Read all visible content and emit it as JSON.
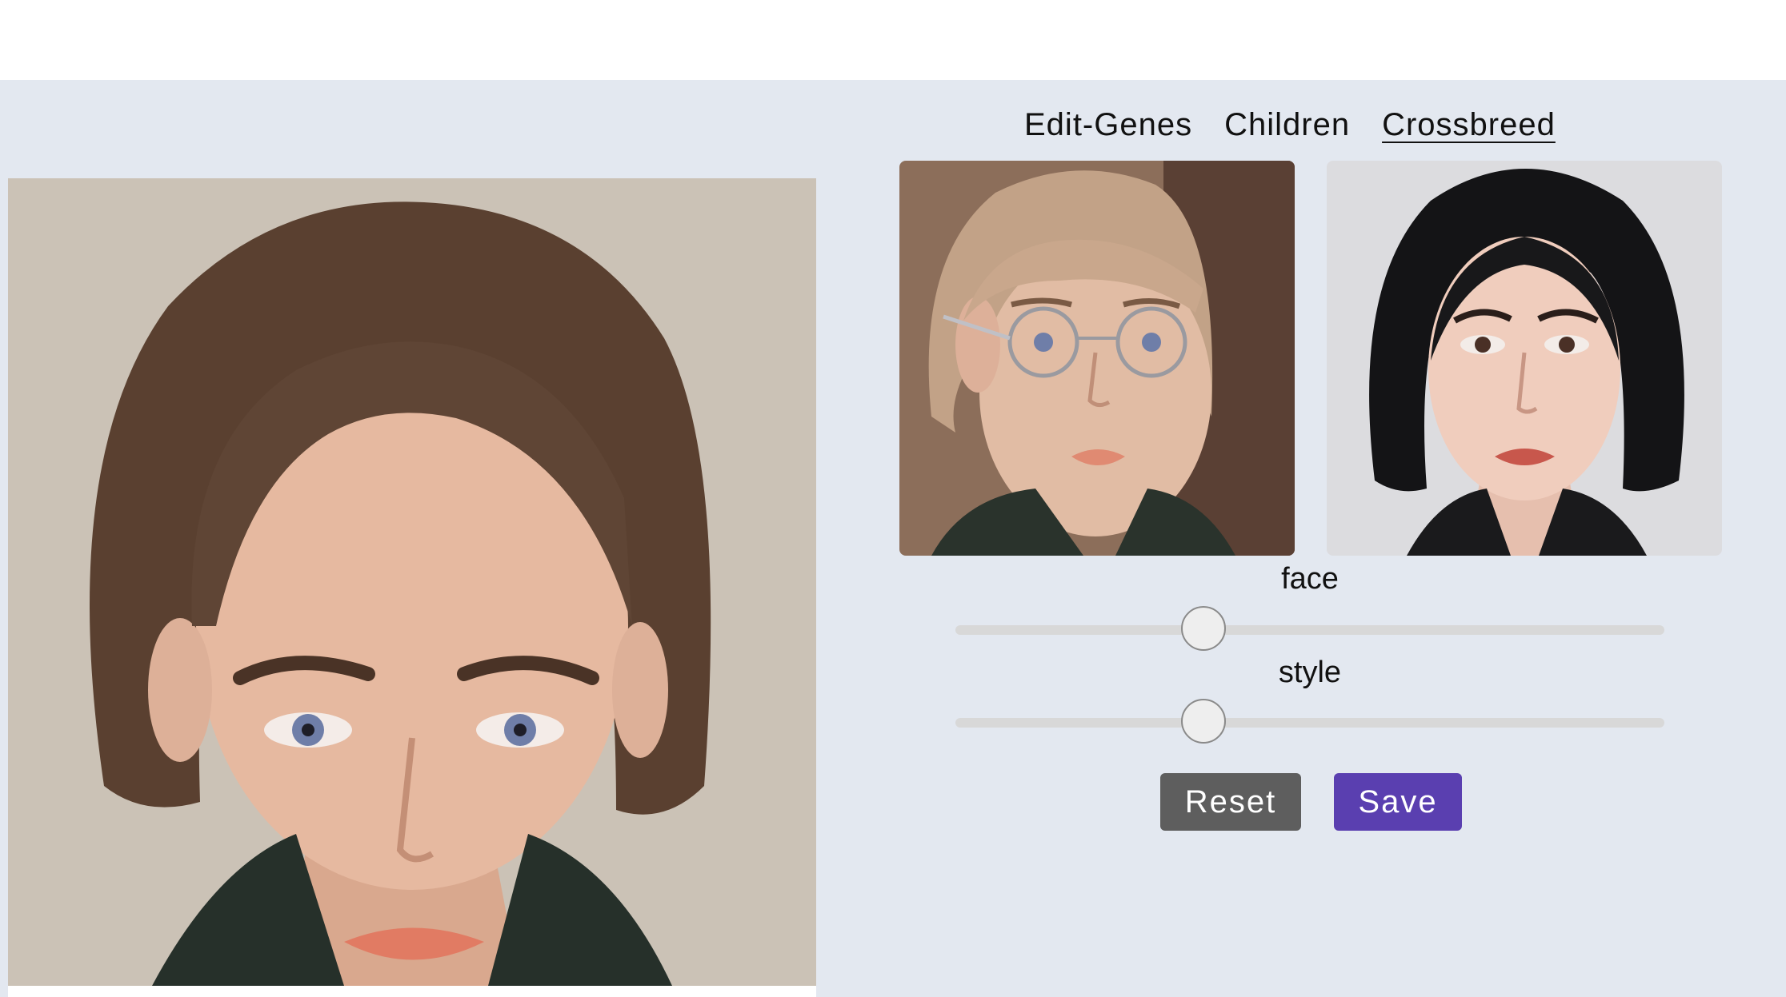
{
  "tabs": [
    {
      "label": "Edit-Genes",
      "active": false
    },
    {
      "label": "Children",
      "active": false
    },
    {
      "label": "Crossbreed",
      "active": true
    }
  ],
  "images": {
    "result": "result-face-image",
    "parent_a": "parent-a-face-image",
    "parent_b": "parent-b-face-image"
  },
  "sliders": {
    "face": {
      "label": "face",
      "value": 0.35
    },
    "style": {
      "label": "style",
      "value": 0.35
    }
  },
  "buttons": {
    "reset": "Reset",
    "save": "Save"
  },
  "colors": {
    "background": "#e3e8f0",
    "reset_button": "#5e5e5e",
    "save_button": "#5a3fb0",
    "slider_track": "#d8d8d8"
  }
}
